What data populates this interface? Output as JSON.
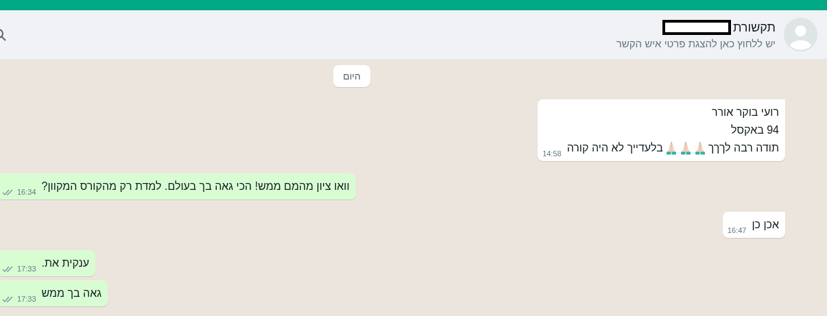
{
  "header": {
    "name": "תקשורת",
    "name_redacted": true,
    "subtitle": "יש ללחוץ כאן להצגת פרטי איש הקשר"
  },
  "date_chip": "היום",
  "messages": [
    {
      "kind": "in",
      "lines": [
        [
          {
            "kind": "text",
            "text": "רועי בוקר אורר"
          }
        ],
        [
          {
            "kind": "text",
            "text": "94 באקסל"
          }
        ],
        [
          {
            "kind": "text",
            "text": "תודה רבה לךךך"
          },
          {
            "kind": "emoji"
          },
          {
            "kind": "emoji"
          },
          {
            "kind": "emoji"
          },
          {
            "kind": "text",
            "text": "בלעדייך לא היה קורה"
          }
        ]
      ],
      "time": "14:58"
    },
    {
      "kind": "out",
      "lines": [
        [
          {
            "kind": "text",
            "text": "וואו ציון מהמם ממש! הכי גאה בך בעולם. למדת רק מהקורס המקוון?"
          }
        ]
      ],
      "time": "16:34",
      "read": false
    },
    {
      "kind": "in",
      "lines": [
        [
          {
            "kind": "text",
            "text": "אכן כן"
          }
        ]
      ],
      "time": "16:47"
    },
    {
      "kind": "out",
      "lines": [
        [
          {
            "kind": "text",
            "text": "ענקית את."
          }
        ]
      ],
      "time": "17:33",
      "read": false
    },
    {
      "kind": "out",
      "lines": [
        [
          {
            "kind": "text",
            "text": "גאה בך ממש"
          }
        ]
      ],
      "time": "17:33",
      "read": false
    }
  ]
}
